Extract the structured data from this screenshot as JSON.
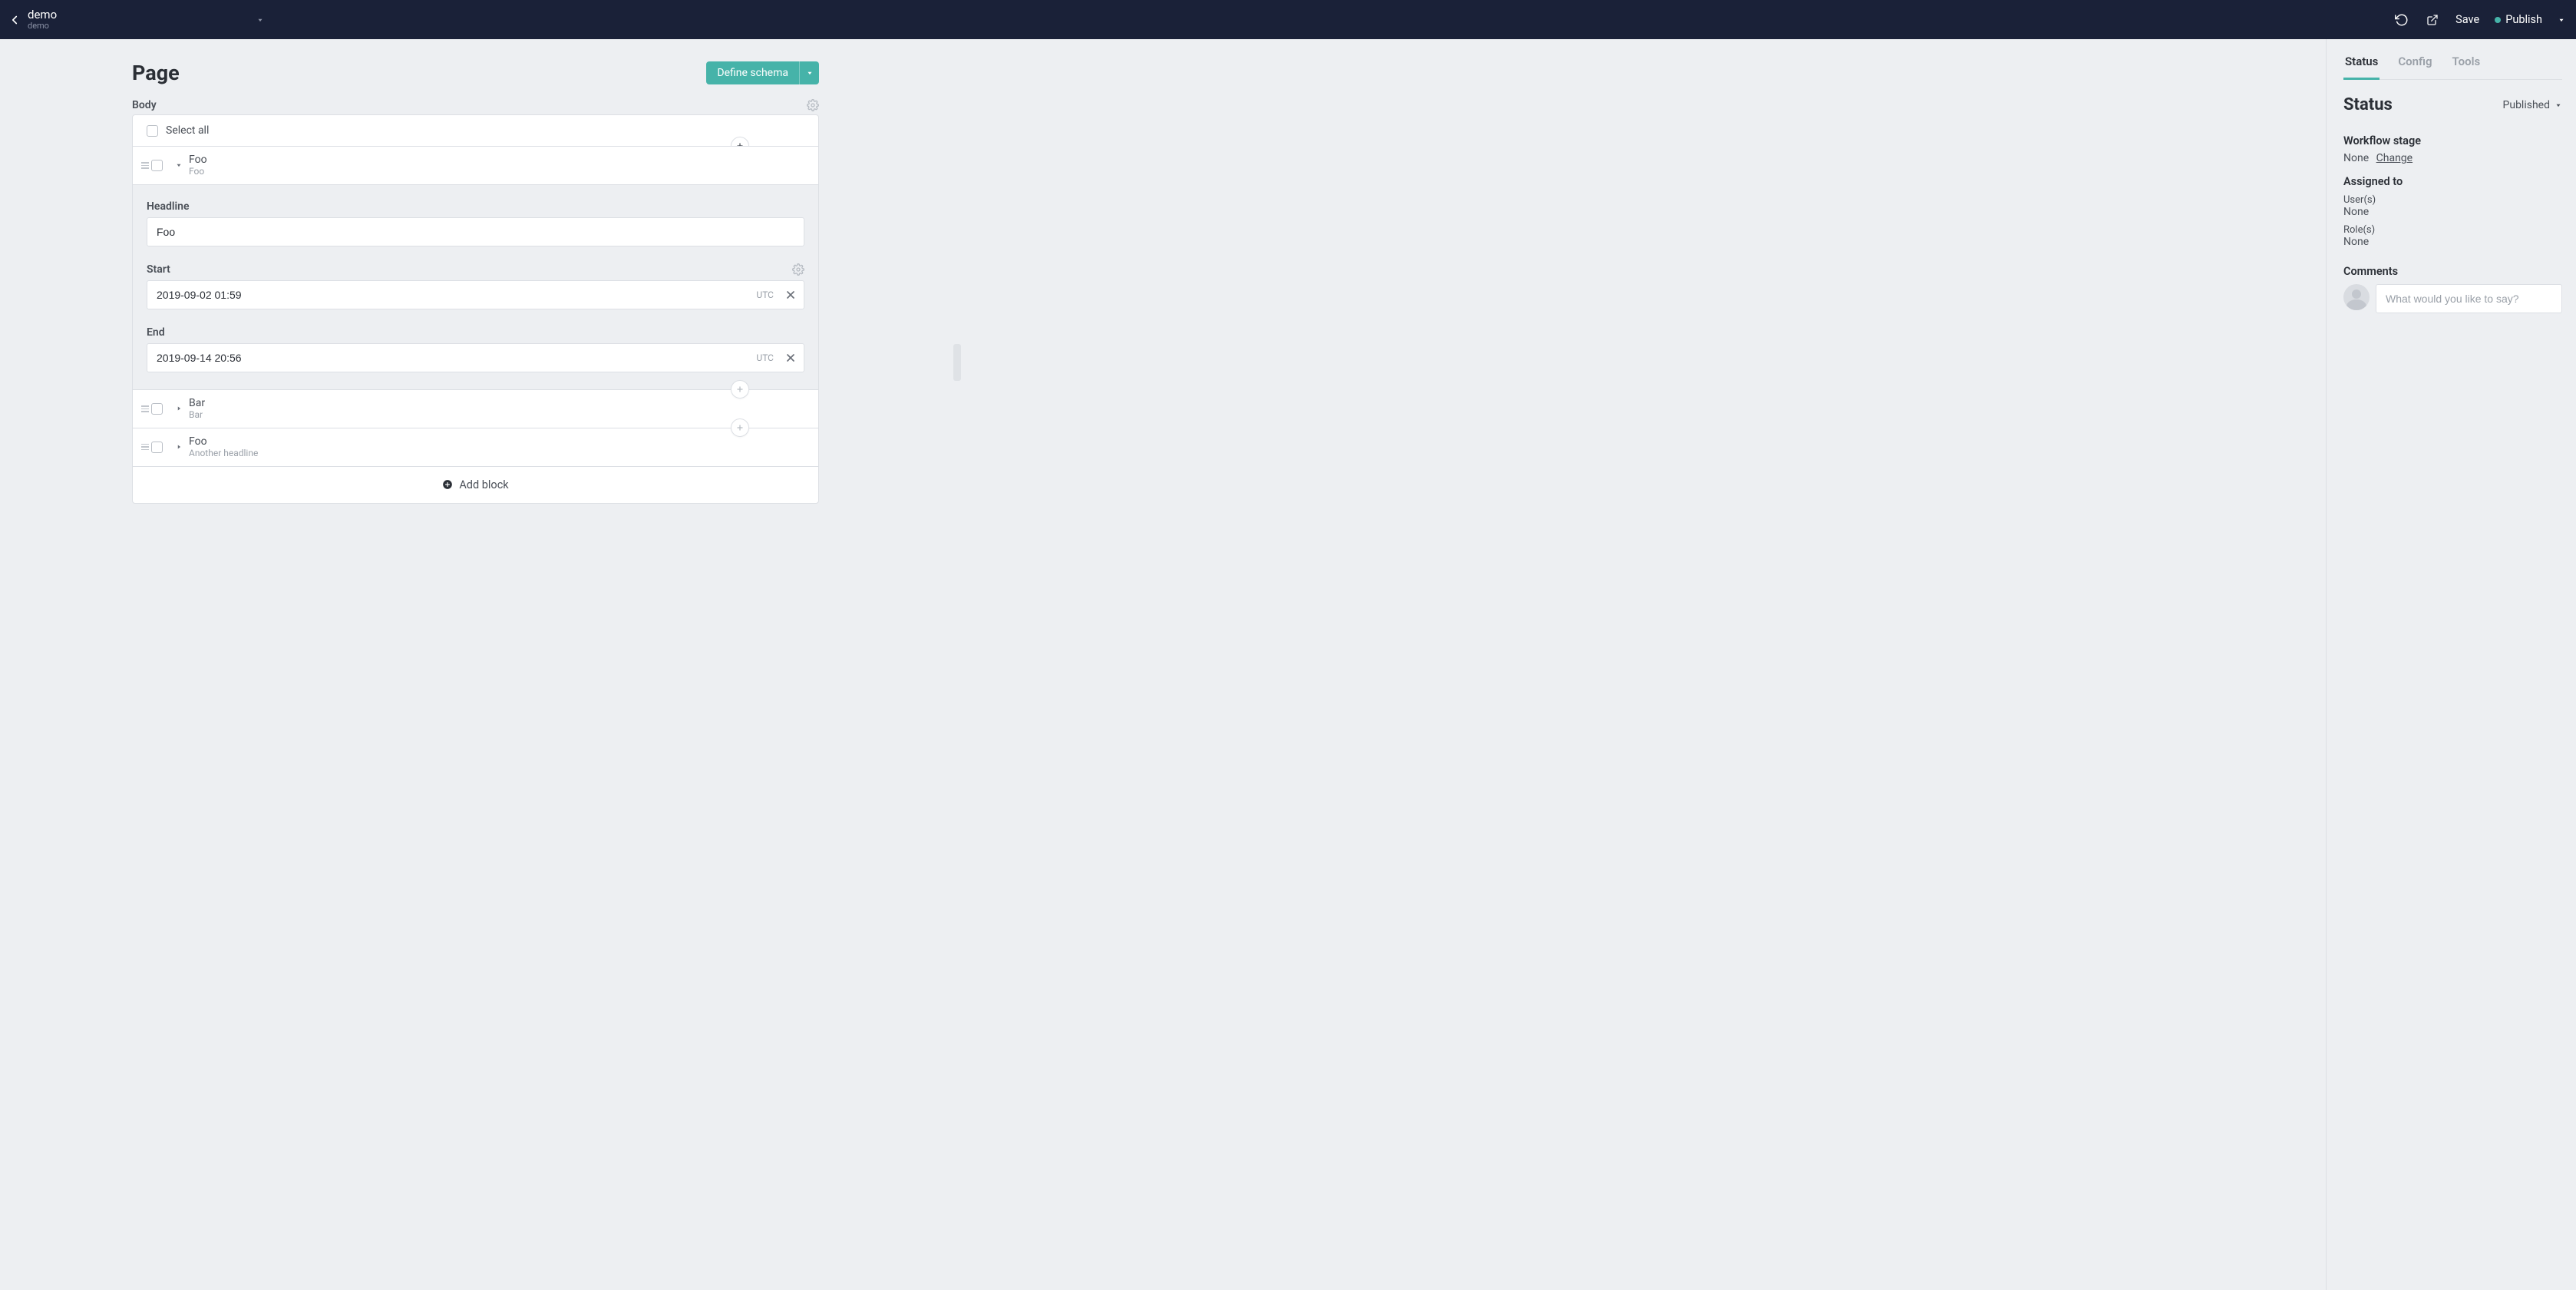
{
  "topbar": {
    "title": "demo",
    "subtitle": "demo",
    "save_label": "Save",
    "publish_label": "Publish"
  },
  "page": {
    "heading": "Page",
    "schema_button": "Define schema",
    "body_label": "Body",
    "select_all": "Select all",
    "add_block": "Add block",
    "blocks": [
      {
        "name": "Foo",
        "summary": "Foo",
        "expanded": true,
        "fields": {
          "headline_label": "Headline",
          "headline_value": "Foo",
          "start_label": "Start",
          "start_value": "2019-09-02 01:59",
          "start_tz": "UTC",
          "end_label": "End",
          "end_value": "2019-09-14 20:56",
          "end_tz": "UTC"
        }
      },
      {
        "name": "Bar",
        "summary": "Bar",
        "expanded": false
      },
      {
        "name": "Foo",
        "summary": "Another headline",
        "expanded": false
      }
    ]
  },
  "sidebar": {
    "tabs": {
      "status": "Status",
      "config": "Config",
      "tools": "Tools"
    },
    "heading": "Status",
    "publish_state": "Published",
    "workflow_stage_label": "Workflow stage",
    "workflow_stage_value": "None",
    "change_link": "Change",
    "assigned_label": "Assigned to",
    "users_label": "User(s)",
    "users_value": "None",
    "roles_label": "Role(s)",
    "roles_value": "None",
    "comments_label": "Comments",
    "comment_placeholder": "What would you like to say?"
  }
}
